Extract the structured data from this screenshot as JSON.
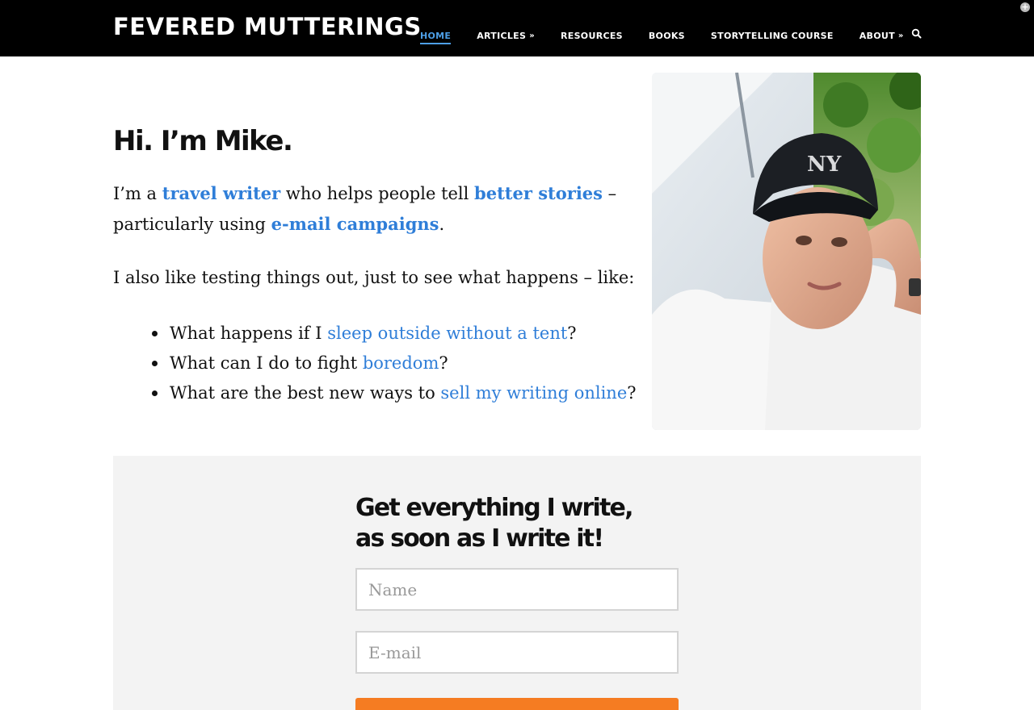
{
  "site": {
    "brand": "FEVERED MUTTERINGS"
  },
  "nav": {
    "items": [
      {
        "label": "HOME"
      },
      {
        "label": "ARTICLES"
      },
      {
        "label": "RESOURCES"
      },
      {
        "label": "BOOKS"
      },
      {
        "label": "STORYTELLING COURSE"
      },
      {
        "label": "ABOUT"
      }
    ],
    "dropdown_glyph": "»",
    "search_icon": "search-icon"
  },
  "hero": {
    "heading": "Hi. I’m Mike.",
    "intro": {
      "p1": "I’m a ",
      "link1": "travel writer",
      "p2": " who helps people tell ",
      "link2": "better stories",
      "p3": " – particularly using ",
      "link3": "e-mail campaigns",
      "p4": "."
    },
    "also": "I also like testing things out, just to see what happens – like:",
    "list": [
      {
        "before": "What happens if I ",
        "link": "sleep outside without a tent",
        "after": "?"
      },
      {
        "before": "What can I do to fight ",
        "link": "boredom",
        "after": "?"
      },
      {
        "before": "What are the best new ways to ",
        "link": "sell my writing online",
        "after": "?"
      }
    ]
  },
  "signup": {
    "title": "Get everything I write, as soon as I write it!",
    "name_placeholder": "Name",
    "email_placeholder": "E-mail"
  },
  "colors": {
    "link": "#2f7ed8",
    "nav_active": "#4d9fe6",
    "button": "#f57c22",
    "navbar": "#000000",
    "panel": "#f3f3f3"
  }
}
